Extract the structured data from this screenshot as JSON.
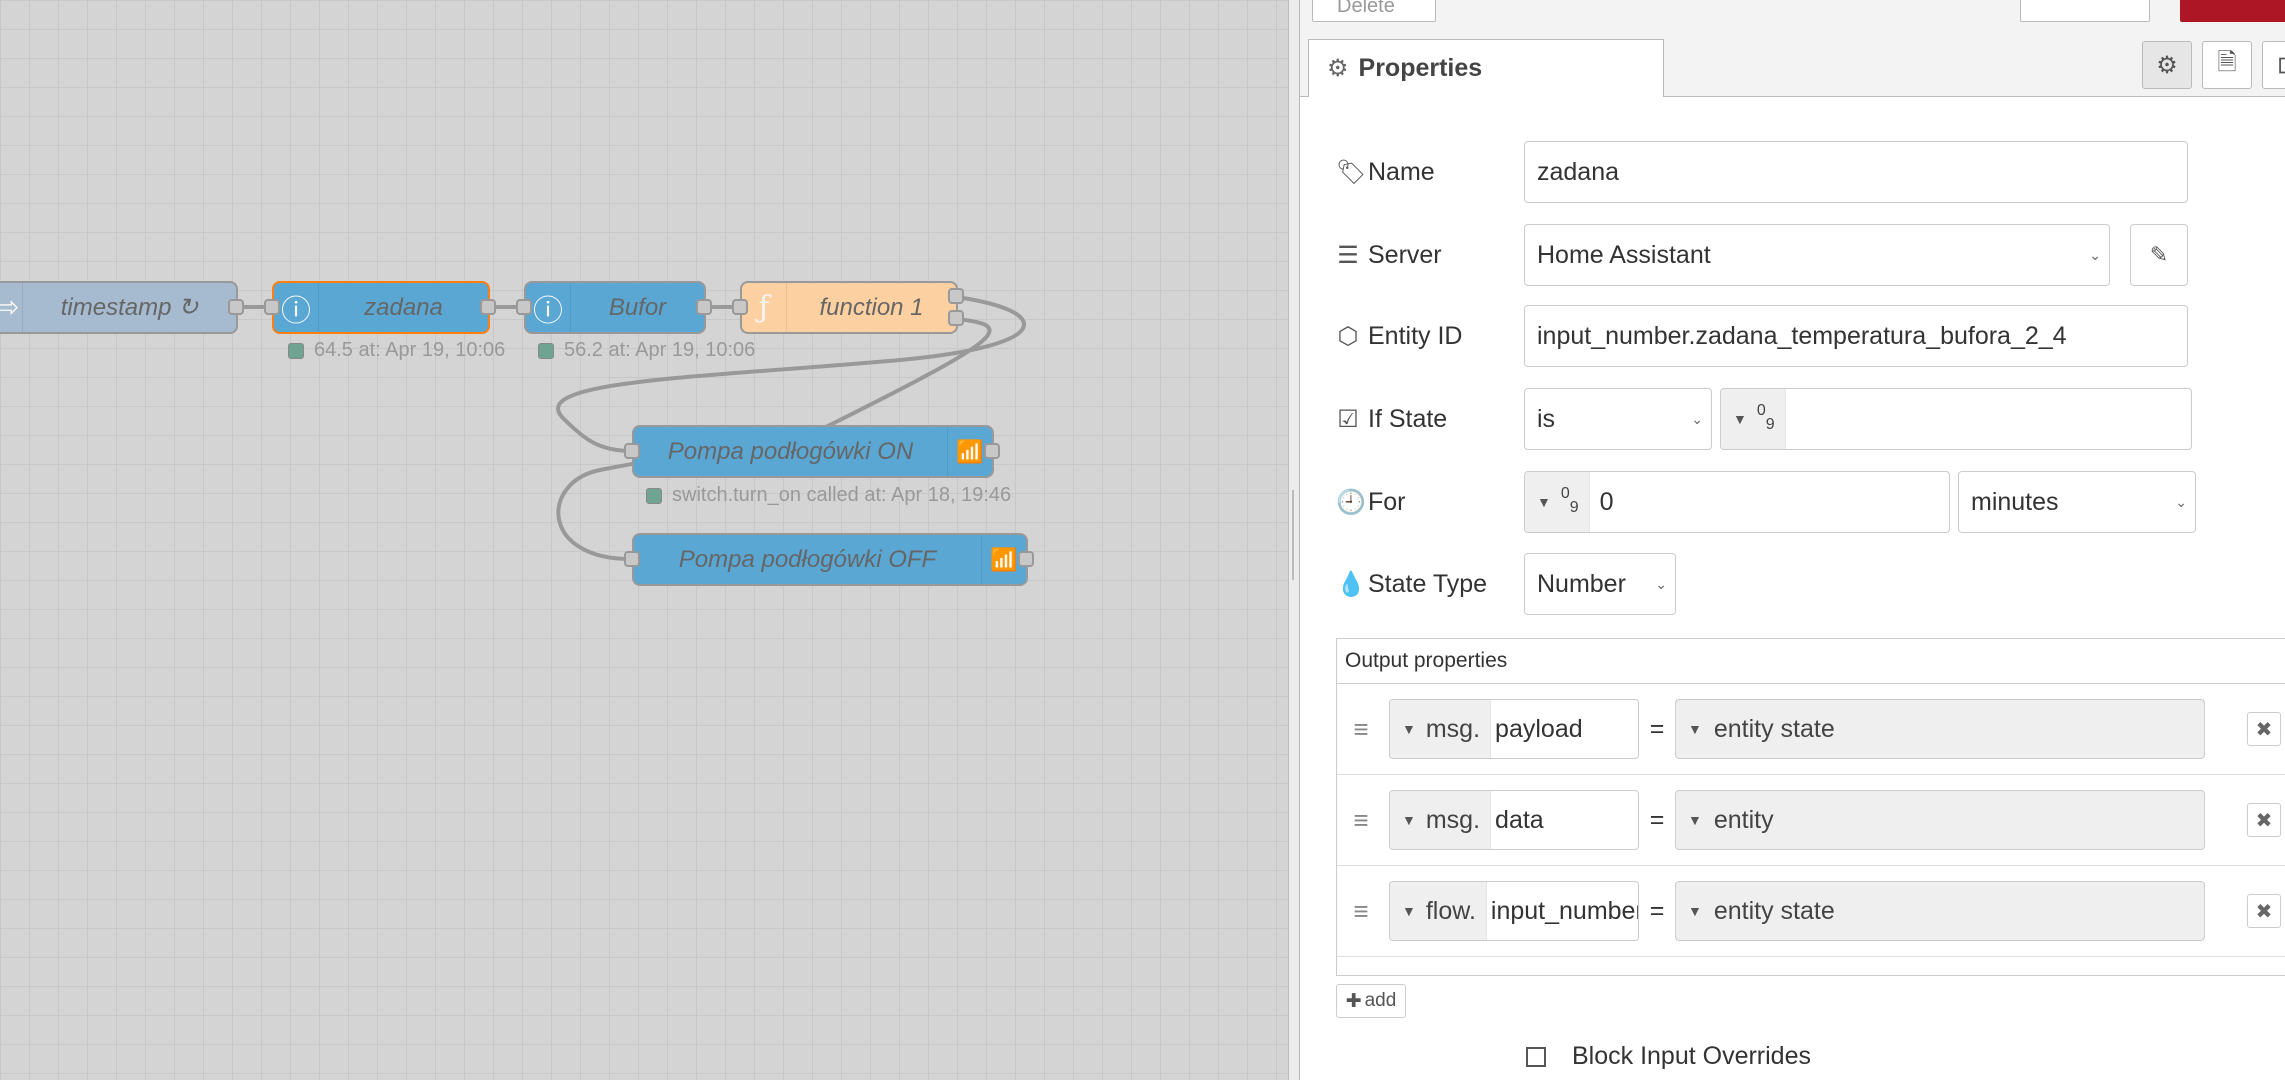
{
  "flow": {
    "nodes": {
      "timestamp": {
        "label": "timestamp ↻",
        "color": "#a6bbcf"
      },
      "zadana": {
        "label": "zadana",
        "color": "#5aa7d4",
        "selected_border": "#ff7f0e",
        "status": "64.5 at: Apr 19, 10:06"
      },
      "bufor": {
        "label": "Bufor",
        "color": "#5aa7d4",
        "status": "56.2 at: Apr 19, 10:06"
      },
      "function": {
        "label": "function 1",
        "color": "#fdd0a2"
      },
      "pompa_on": {
        "label": "Pompa podłogówki ON",
        "color": "#5aa7d4",
        "status": "switch.turn_on called at: Apr 18, 19:46"
      },
      "pompa_off": {
        "label": "Pompa podłogówki OFF",
        "color": "#5aa7d4"
      }
    }
  },
  "panel": {
    "top_left_button": "Delete",
    "tab": {
      "label": "Properties",
      "icon": "gear-icon"
    },
    "tab_icons": [
      "gear-icon",
      "document-icon",
      "frame-icon"
    ],
    "fields": {
      "name": {
        "label": "Name",
        "value": "zadana",
        "icon": "tag-icon"
      },
      "server": {
        "label": "Server",
        "value": "Home Assistant",
        "icon": "server-icon"
      },
      "entity_id": {
        "label": "Entity ID",
        "value": "input_number.zadana_temperatura_bufora_2_4",
        "icon": "cube-icon"
      },
      "if_state": {
        "label": "If State",
        "operator": "is",
        "type": "09",
        "value": "",
        "icon": "checkbox-icon"
      },
      "for": {
        "label": "For",
        "type": "09",
        "value": "0",
        "unit": "minutes",
        "icon": "clock-icon"
      },
      "state_type": {
        "label": "State Type",
        "value": "Number",
        "icon": "drop-icon"
      }
    },
    "output_properties": {
      "title": "Output properties",
      "rows": [
        {
          "prefix": "msg.",
          "property": "payload",
          "eq": "=",
          "value": "entity state"
        },
        {
          "prefix": "msg.",
          "property": "data",
          "eq": "=",
          "value": "entity"
        },
        {
          "prefix": "flow.",
          "property": "input_number",
          "eq": "=",
          "value": "entity state"
        }
      ],
      "add_label": "add"
    },
    "block_input_overrides": {
      "label": "Block Input Overrides",
      "checked": false
    }
  },
  "colors": {
    "accent_red": "#ad1625",
    "grid": "#d4d4d4"
  }
}
